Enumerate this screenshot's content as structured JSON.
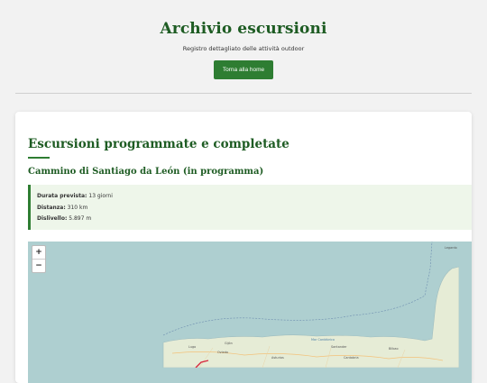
{
  "header": {
    "title": "Archivio escursioni",
    "subtitle": "Registro dettagliato delle attività outdoor",
    "home_button": "Torna alla home"
  },
  "section": {
    "title": "Escursioni programmate e completate"
  },
  "trip": {
    "title": "Cammino di Santiago da León (in programma)",
    "stats": [
      {
        "label": "Durata prevista:",
        "value": "13 giorni"
      },
      {
        "label": "Distanza:",
        "value": "310 km"
      },
      {
        "label": "Dislivello:",
        "value": "5.897 m"
      }
    ]
  },
  "map": {
    "zoom_in": "+",
    "zoom_out": "−",
    "places": [
      "Gijón",
      "Oviedo",
      "Santander",
      "Bilbao",
      "Cantabria",
      "Asturias",
      "Mar Cantábrico",
      "Lugo",
      "Legardo"
    ],
    "colors": {
      "sea": "#aecfd0",
      "land": "#e6ecd6",
      "route": "#d7263d"
    }
  }
}
